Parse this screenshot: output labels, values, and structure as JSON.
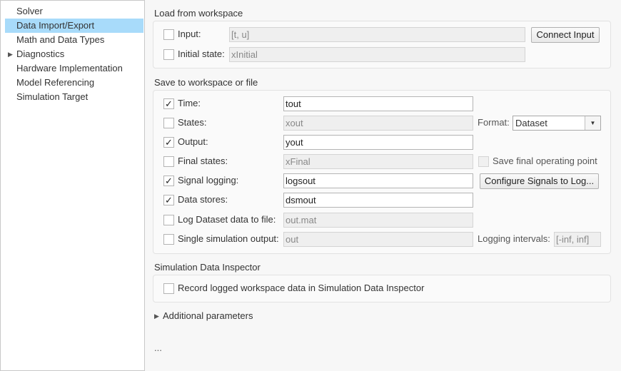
{
  "sidebar": {
    "items": [
      {
        "label": "Solver"
      },
      {
        "label": "Data Import/Export",
        "selected": true
      },
      {
        "label": "Math and Data Types"
      },
      {
        "label": "Diagnostics",
        "expandable": true
      },
      {
        "label": "Hardware Implementation"
      },
      {
        "label": "Model Referencing"
      },
      {
        "label": "Simulation Target"
      }
    ]
  },
  "load": {
    "title": "Load from workspace",
    "input_label": "Input:",
    "input_value": "[t, u]",
    "initial_label": "Initial state:",
    "initial_value": "xInitial",
    "connect_button": "Connect Input"
  },
  "save": {
    "title": "Save to workspace or file",
    "rows": [
      {
        "label": "Time:",
        "value": "tout",
        "checked": true
      },
      {
        "label": "States:",
        "value": "xout",
        "checked": false
      },
      {
        "label": "Output:",
        "value": "yout",
        "checked": true
      },
      {
        "label": "Final states:",
        "value": "xFinal",
        "checked": false
      },
      {
        "label": "Signal logging:",
        "value": "logsout",
        "checked": true
      },
      {
        "label": "Data stores:",
        "value": "dsmout",
        "checked": true
      },
      {
        "label": "Log Dataset data to file:",
        "value": "out.mat",
        "checked": false
      },
      {
        "label": "Single simulation output:",
        "value": "out",
        "checked": false
      }
    ],
    "format_label": "Format:",
    "format_value": "Dataset",
    "save_final_label": "Save final operating point",
    "configure_button": "Configure Signals to Log...",
    "logging_intervals_label": "Logging intervals:",
    "logging_intervals_value": "[-inf, inf]"
  },
  "sdi": {
    "title": "Simulation Data Inspector",
    "record_label": "Record logged workspace data in Simulation Data Inspector"
  },
  "additional": {
    "label": "Additional parameters"
  },
  "ellipsis": "..."
}
